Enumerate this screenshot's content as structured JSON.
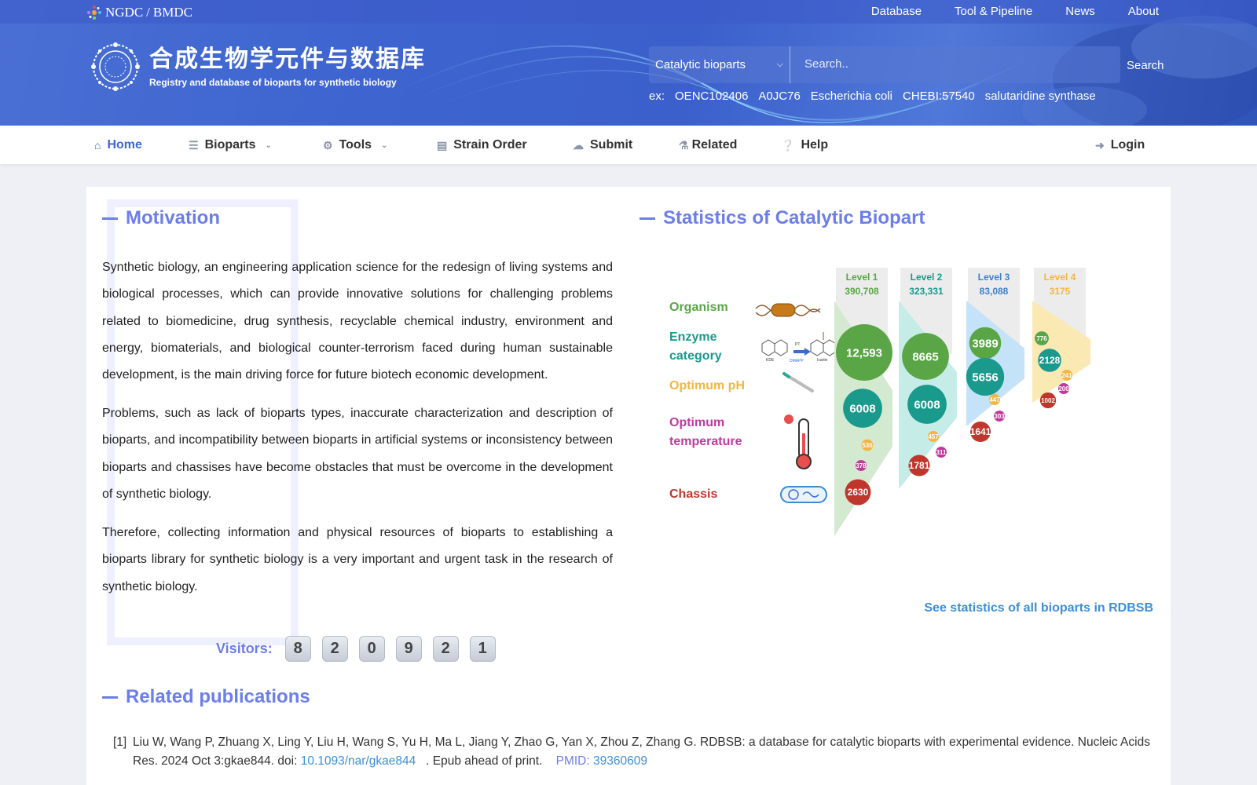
{
  "topbar": {
    "brand_a": "NGDC",
    "brand_sep": "/",
    "brand_b": "BMDC",
    "links": [
      "Database",
      "Tool & Pipeline",
      "News",
      "About"
    ]
  },
  "logo": {
    "title_cn": "合成生物学元件与数据库",
    "subtitle_en": "Registry and database of bioparts for synthetic biology"
  },
  "search": {
    "selected": "Catalytic bioparts",
    "placeholder": "Search..",
    "button": "Search",
    "examples_label": "ex:",
    "examples": [
      "OENC102406",
      "A0JC76",
      "Escherichia coli",
      "CHEBI:57540",
      "salutaridine synthase"
    ]
  },
  "nav": {
    "home": "Home",
    "bioparts": "Bioparts",
    "tools": "Tools",
    "strain_order": "Strain Order",
    "submit": "Submit",
    "related": "Related",
    "help": "Help",
    "login": "Login"
  },
  "motivation": {
    "title": "Motivation",
    "paragraphs": [
      "Synthetic biology, an engineering application science for the redesign of living systems and biological processes, which can provide innovative solutions for challenging problems related to biomedicine, drug synthesis, recyclable chemical industry, environment and energy, biomaterials, and biological counter-terrorism faced during human sustainable development, is the main driving force for future biotech economic development.",
      "Problems, such as lack of bioparts types, inaccurate characterization and description of bioparts, and incompatibility between bioparts in artificial systems or inconsistency between bioparts and chassises have become obstacles that must be overcome in the development of synthetic biology.",
      "Therefore, collecting information and physical resources of bioparts to establishing a bioparts library for synthetic biology is a very important and urgent task in the research of synthetic biology."
    ],
    "visitors_label": "Visitors:",
    "visitor_digits": [
      "8",
      "2",
      "0",
      "9",
      "2",
      "1"
    ]
  },
  "stats": {
    "title": "Statistics of Catalytic Biopart",
    "categories": [
      {
        "label": "Organism",
        "color": "#5aa646"
      },
      {
        "label": "Enzyme category",
        "color": "#1a9a8c"
      },
      {
        "label": "Optimum pH",
        "color": "#f2b640"
      },
      {
        "label": "Optimum temperature",
        "color": "#c2399c"
      },
      {
        "label": "Chassis",
        "color": "#c0362c"
      }
    ],
    "levels": [
      {
        "name": "Level 1",
        "total": "390,708",
        "name_color": "#5aa646",
        "total_color": "#5aa646",
        "fill": "#d4ead0",
        "cat_values": [
          "12,593",
          "6008",
          "536",
          "378",
          "2630"
        ]
      },
      {
        "name": "Level 2",
        "total": "323,331",
        "name_color": "#1a9a8c",
        "total_color": "#1a9a8c",
        "fill": "#c6ece8",
        "cat_values": [
          "8665",
          "6008",
          "457",
          "311",
          "1781"
        ]
      },
      {
        "name": "Level 3",
        "total": "83,088",
        "name_color": "#3e7fd0",
        "total_color": "#3e7fd0",
        "fill": "#c4e2f8",
        "cat_values": [
          "3989",
          "5656",
          "447",
          "303",
          "1641"
        ]
      },
      {
        "name": "Level 4",
        "total": "3175",
        "name_color": "#f2b640",
        "total_color": "#f2b640",
        "fill": "#fbe9b4",
        "cat_values": [
          "776",
          "2128",
          "241",
          "200",
          "1002"
        ]
      }
    ],
    "enzyme_icon_labels": [
      "KDE",
      "PT",
      "DMAPP",
      "Icariin"
    ],
    "see_all": "See statistics of all bioparts in RDBSB"
  },
  "publications": {
    "title": "Related publications",
    "items": [
      {
        "num": "[1]",
        "text": "Liu W, Wang P, Zhuang X, Ling Y, Liu H, Wang S, Yu H, Ma L, Jiang Y, Zhao G, Yan X, Zhou Z, Zhang G. RDBSB: a database for catalytic bioparts with experimental evidence. Nucleic Acids Res. 2024 Oct 3:gkae844. doi:",
        "doi": "10.1093/nar/gkae844",
        "epub": ". Epub ahead of print.",
        "pmid_label": "PMID:",
        "pmid": "39360609"
      }
    ]
  },
  "colors": {
    "accent": "#6c7ee8",
    "link": "#3d8fd6",
    "banner": "#3d64cf"
  }
}
